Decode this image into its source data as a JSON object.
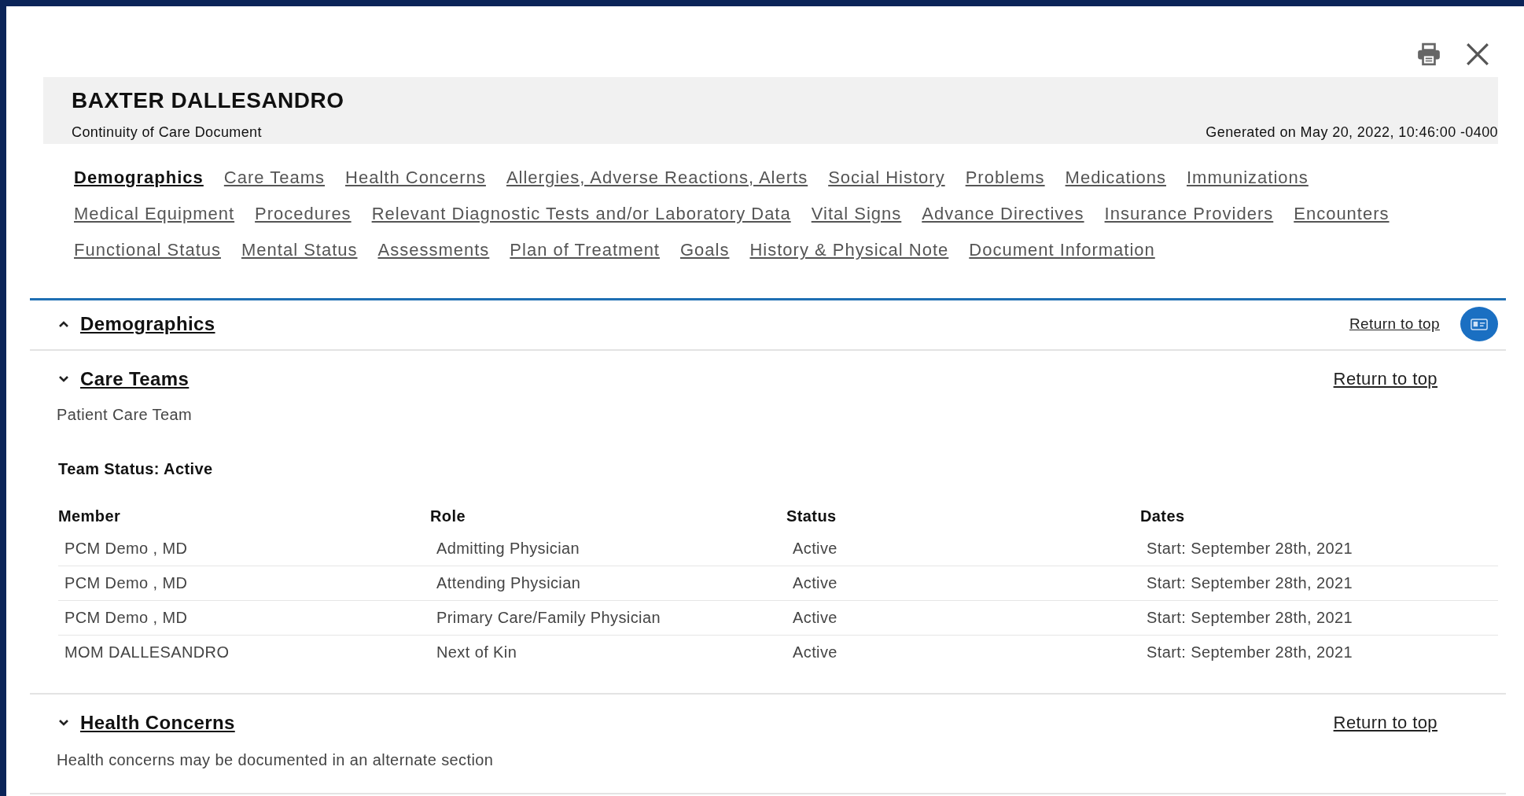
{
  "header": {
    "patient_name": "BAXTER DALLESANDRO",
    "document_type": "Continuity of Care Document",
    "generated": "Generated on May 20, 2022, 10:46:00 -0400"
  },
  "nav_rows": [
    [
      {
        "label": "Demographics",
        "selected": true
      },
      {
        "label": "Care Teams",
        "selected": false
      },
      {
        "label": "Health Concerns",
        "selected": false
      },
      {
        "label": "Allergies, Adverse Reactions, Alerts",
        "selected": false
      },
      {
        "label": "Social History",
        "selected": false
      },
      {
        "label": "Problems",
        "selected": false
      },
      {
        "label": "Medications",
        "selected": false
      },
      {
        "label": "Immunizations",
        "selected": false
      }
    ],
    [
      {
        "label": "Medical Equipment",
        "selected": false
      },
      {
        "label": "Procedures",
        "selected": false
      },
      {
        "label": "Relevant Diagnostic Tests and/or Laboratory Data",
        "selected": false
      },
      {
        "label": "Vital Signs",
        "selected": false
      },
      {
        "label": "Advance Directives",
        "selected": false
      },
      {
        "label": "Insurance Providers",
        "selected": false
      },
      {
        "label": "Encounters",
        "selected": false
      }
    ],
    [
      {
        "label": "Functional Status",
        "selected": false
      },
      {
        "label": "Mental Status",
        "selected": false
      },
      {
        "label": "Assessments",
        "selected": false
      },
      {
        "label": "Plan of Treatment",
        "selected": false
      },
      {
        "label": "Goals",
        "selected": false
      },
      {
        "label": "History & Physical Note",
        "selected": false
      },
      {
        "label": "Document Information",
        "selected": false
      }
    ]
  ],
  "sections": [
    {
      "title": "Demographics",
      "expanded": false,
      "return_link": "Return to top"
    },
    {
      "kind": "care_team",
      "title": "Care Teams",
      "expanded": true,
      "return_link": "Return to top",
      "subtitle": "Patient Care Team",
      "team_status": "Team Status: Active",
      "table": {
        "columns": [
          "Member",
          "Role",
          "Status",
          "Dates"
        ],
        "rows": [
          [
            "PCM Demo , MD",
            "Admitting Physician",
            "Active",
            "Start: September 28th, 2021"
          ],
          [
            "PCM Demo , MD",
            "Attending Physician",
            "Active",
            "Start: September 28th, 2021"
          ],
          [
            "PCM Demo , MD",
            "Primary Care/Family Physician",
            "Active",
            "Start: September 28th, 2021"
          ],
          [
            "MOM DALLESANDRO",
            "Next of Kin",
            "Active",
            "Start: September 28th, 2021"
          ]
        ]
      }
    },
    {
      "kind": "note",
      "title": "Health Concerns",
      "expanded": true,
      "return_link": "Return to top",
      "note": "Health concerns may be documented in an alternate section"
    }
  ]
}
